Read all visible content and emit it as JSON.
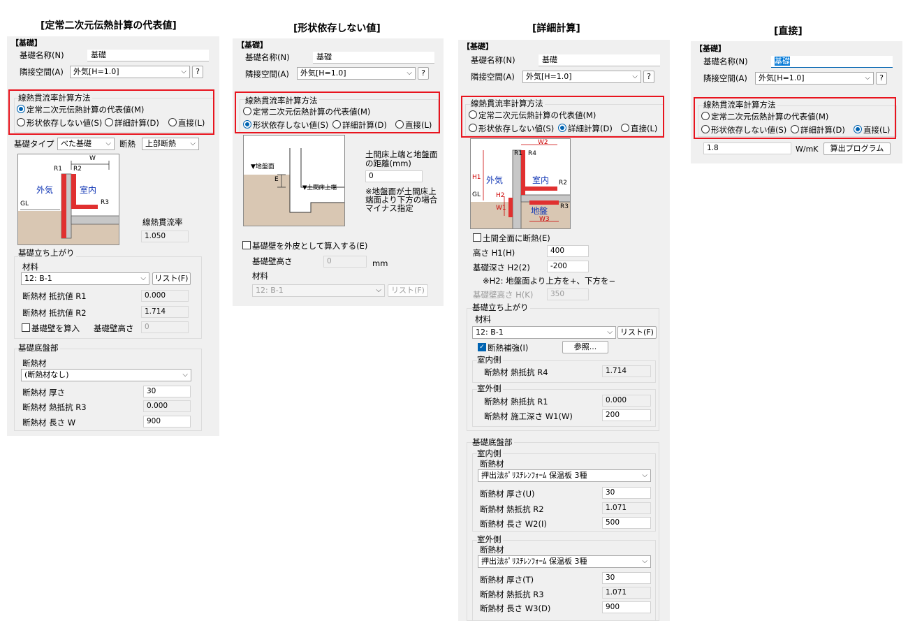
{
  "titles": [
    "[定常二次元伝熱計算の代表値]",
    "[形状依存しない値]",
    "[詳細計算]",
    "[直接]"
  ],
  "common": {
    "header": "【基礎】",
    "name_label": "基礎名称(N)",
    "name_value": "基礎",
    "adj_label": "隣接空間(A)",
    "adj_value": "外気[H=1.0]",
    "help": "?",
    "method_title": "線熱貫流率計算方法",
    "opt_rep": "定常二次元伝熱計算の代表値(M)",
    "opt_shape": "形状依存しない値(S)",
    "opt_detail": "詳細計算(D)",
    "opt_direct": "直接(L)",
    "list_btn": "リスト(F)",
    "material": "材料",
    "material_value": "12: B-1"
  },
  "p1": {
    "type_label": "基礎タイプ",
    "type_value": "べた基礎",
    "ins_label": "断熱",
    "ins_value": "上部断熱",
    "diag": {
      "w": "W",
      "r1": "R1",
      "r2": "R2",
      "r3": "R3",
      "outside": "外気",
      "inside": "室内",
      "gl": "GL"
    },
    "psi_label": "線熱貫流率",
    "psi_value": "1.050",
    "rise_group": "基礎立ち上がり",
    "r1_label": "断熱材  抵抗値  R1",
    "r1_value": "0.000",
    "r2_label": "断熱材  抵抗値  R2",
    "r2_value": "1.714",
    "wall_chk": "基礎壁を算入",
    "wall_h_label": "基礎壁高さ",
    "wall_h_value": "0",
    "bottom_group": "基礎底盤部",
    "ins_mat_label": "断熱材",
    "ins_mat_value": "(断熱材なし)",
    "thick_label": "断熱材 厚さ",
    "thick_value": "30",
    "r3_label": "断熱材 熱抵抗 R3",
    "r3_value": "0.000",
    "len_label": "断熱材 長さ W",
    "len_value": "900"
  },
  "p2": {
    "diag": {
      "gl": "▼地盤面",
      "e": "E",
      "floor": "▼土間床上端"
    },
    "dist_label": "土間床上端と地盤面の距離(mm)",
    "dist_value": "0",
    "note": "※地盤面が土間床上端面より下方の場合マイナス指定",
    "wall_chk": "基礎壁を外皮として算入する(E)",
    "wall_h_label": "基礎壁高さ",
    "wall_h_value": "0",
    "mm": "mm"
  },
  "p3": {
    "diag": {
      "w2": "W2",
      "r1": "R1",
      "r4": "R4",
      "h1": "H1",
      "outside": "外気",
      "inside": "室内",
      "r2": "R2",
      "gl": "GL",
      "h2": "H2",
      "w1": "W1",
      "ground": "地盤",
      "r3": "R3",
      "w3": "W3"
    },
    "full_chk": "土間全面に断熱(E)",
    "h1_label": "高さ H1(H)",
    "h1_value": "400",
    "h2_label": "基礎深さ H2(2)",
    "h2_value": "-200",
    "h2_note": "※H2: 地盤面より上方を+、下方を−",
    "wall_h_label": "基礎壁高さ H(K)",
    "wall_h_value": "350",
    "rise_group": "基礎立ち上がり",
    "reinf_chk": "断熱補強(I)",
    "ref_btn": "参照...",
    "in_side": "室内側",
    "r4_label": "断熱材  熱抵抗  R4",
    "r4_value": "1.714",
    "out_side": "室外側",
    "r1_label": "断熱材 熱抵抗 R1",
    "r1_value": "0.000",
    "w1_label": "断熱材 施工深さ W1(W)",
    "w1_value": "200",
    "bottom_group": "基礎底盤部",
    "ins_mat_label": "断熱材",
    "ins_mat_value": "押出法ﾎﾟﾘｽﾁﾚﾝﾌｫｰﾑ 保温板 3種",
    "u_label": "断熱材 厚さ(U)",
    "u_value": "30",
    "r2_label": "断熱材 熱抵抗 R2",
    "r2_value": "1.071",
    "w2_label": "断熱材 長さ W2(I)",
    "w2_value": "500",
    "t_label": "断熱材 厚さ(T)",
    "t_value": "30",
    "r3_label": "断熱材 熱抵抗 R3",
    "r3_value": "1.071",
    "w3_label": "断熱材 長さ W3(D)",
    "w3_value": "900"
  },
  "p4": {
    "psi_value": "1.8",
    "unit": "W/mK",
    "calc_btn": "算出プログラム"
  },
  "colors": {
    "highlight": "#e8141e",
    "panel": "#f0f0f0",
    "accent": "#0063b1",
    "ground": "#d9c7b3",
    "insulation": "#e03030"
  }
}
